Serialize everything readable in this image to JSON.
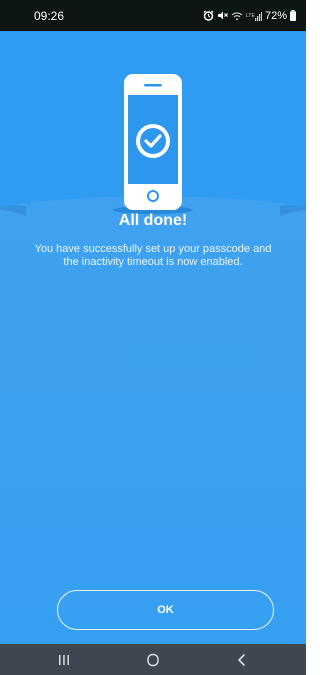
{
  "status_bar": {
    "time": "09:26",
    "battery": "72%",
    "icons": [
      "alarm-icon",
      "mute-icon",
      "wifi-calling-icon",
      "signal-icon",
      "battery-icon"
    ]
  },
  "main": {
    "illustration_icon": "phone-check-icon",
    "title": "All done!",
    "message": "You have successfully set up your passcode and the inactivity timeout is now enabled.",
    "ok_label": "OK"
  },
  "nav_bar": {
    "icons": [
      "recent-apps-icon",
      "home-icon",
      "back-icon"
    ]
  },
  "colors": {
    "background": "#2a95ec",
    "status_bar": "#0d1612",
    "nav_bar": "#3e4652",
    "accent": "#2196f3",
    "text": "#ffffff"
  }
}
